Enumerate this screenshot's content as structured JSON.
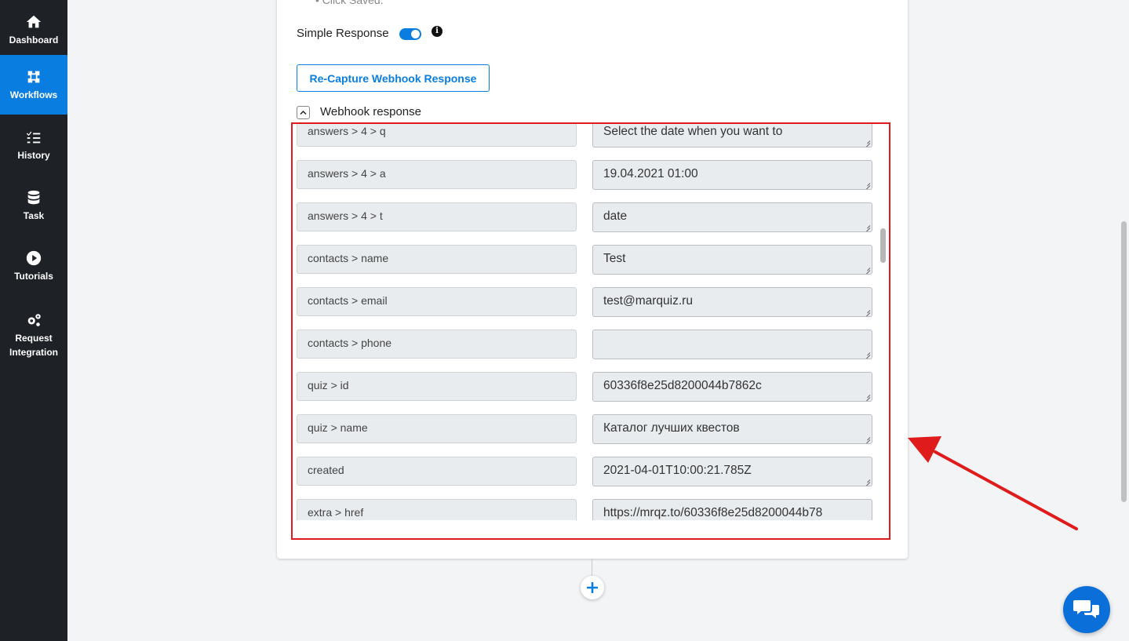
{
  "sidebar": {
    "items": [
      {
        "label": "Dashboard",
        "icon": "home-icon"
      },
      {
        "label": "Workflows",
        "icon": "workflow-icon",
        "active": true
      },
      {
        "label": "History",
        "icon": "checklist-icon"
      },
      {
        "label": "Task",
        "icon": "database-icon"
      },
      {
        "label": "Tutorials",
        "icon": "play-icon"
      },
      {
        "label": "Request Integration",
        "icon": "gears-icon"
      }
    ]
  },
  "config": {
    "clipped_bullet": "• Click Saved.",
    "simple_response_label": "Simple Response",
    "simple_response_enabled": true,
    "recapture_button": "Re-Capture Webhook Response",
    "webhook_response_title": "Webhook response"
  },
  "fields": [
    {
      "key": "answers > 4 > q",
      "value": "Select the date when you want to"
    },
    {
      "key": "answers > 4 > a",
      "value": "19.04.2021 01:00"
    },
    {
      "key": "answers > 4 > t",
      "value": "date"
    },
    {
      "key": "contacts > name",
      "value": "Test"
    },
    {
      "key": "contacts > email",
      "value": "test@marquiz.ru"
    },
    {
      "key": "contacts > phone",
      "value": ""
    },
    {
      "key": "quiz > id",
      "value": "60336f8e25d8200044b7862c"
    },
    {
      "key": "quiz > name",
      "value": "Каталог лучших квестов"
    },
    {
      "key": "created",
      "value": "2021-04-01T10:00:21.785Z"
    },
    {
      "key": "extra > href",
      "value": "https://mrqz.to/60336f8e25d8200044b78"
    }
  ],
  "colors": {
    "sidebar_bg": "#1e2126",
    "accent": "#0a7ee0",
    "highlight": "#e01b1b"
  }
}
